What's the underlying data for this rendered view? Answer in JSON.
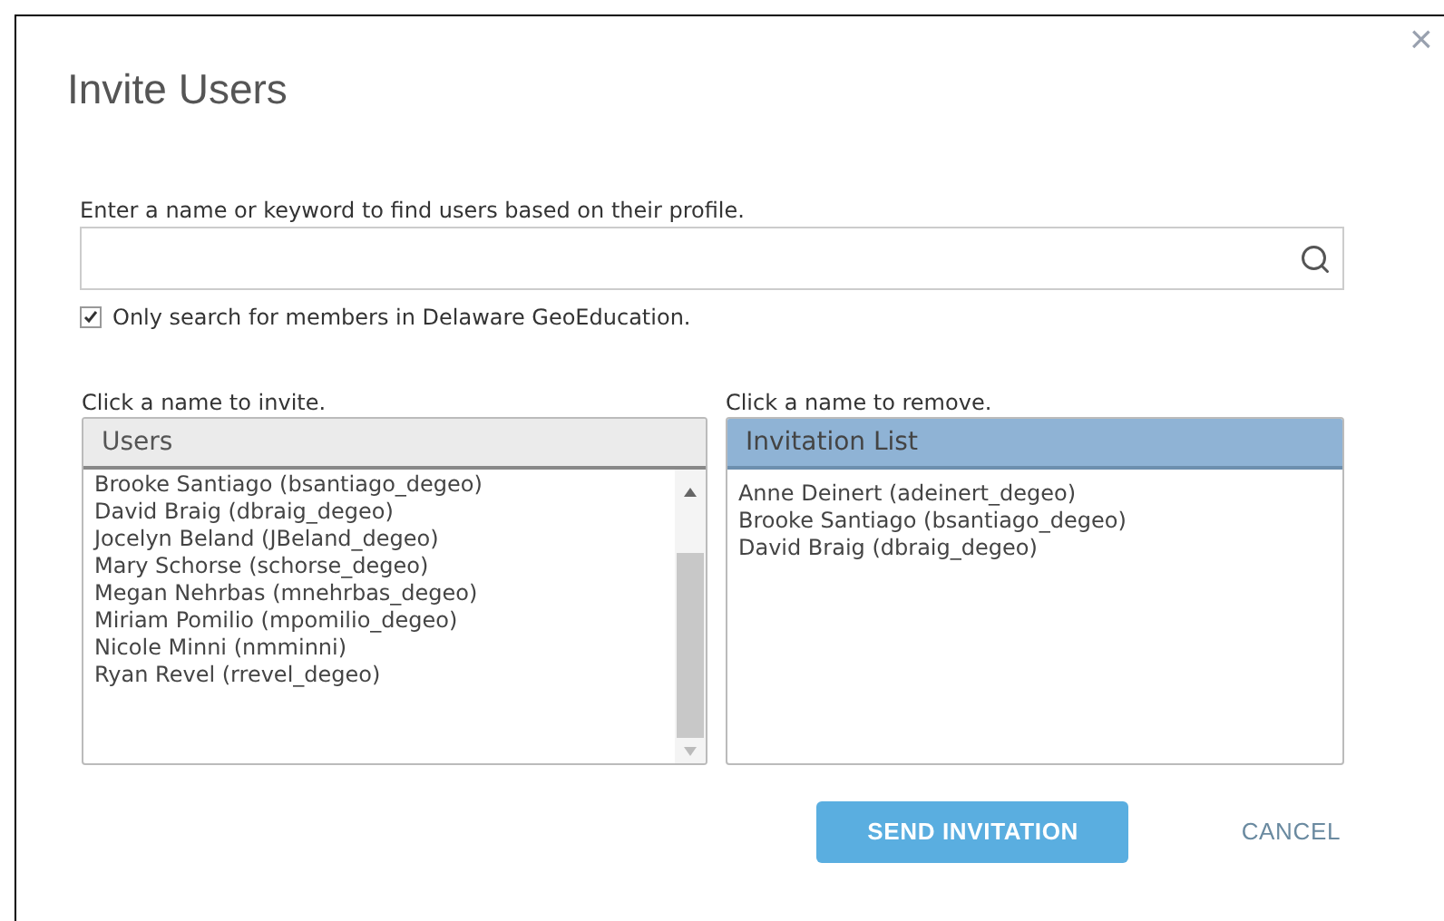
{
  "dialog": {
    "title": "Invite Users",
    "close": "×"
  },
  "search": {
    "label": "Enter a name or keyword to find users based on their profile."
  },
  "filter": {
    "label": "Only search for members in Delaware GeoEducation.",
    "checked": true
  },
  "users": {
    "hint": "Click a name to invite.",
    "header": "Users",
    "items": [
      "Brooke Santiago (bsantiago_degeo)",
      "David Braig (dbraig_degeo)",
      "Jocelyn Beland (JBeland_degeo)",
      "Mary Schorse (schorse_degeo)",
      "Megan Nehrbas (mnehrbas_degeo)",
      "Miriam Pomilio (mpomilio_degeo)",
      "Nicole Minni (nmminni)",
      "Ryan Revel (rrevel_degeo)"
    ]
  },
  "invitations": {
    "hint": "Click a name to remove.",
    "header": "Invitation List",
    "items": [
      "Anne Deinert (adeinert_degeo)",
      "Brooke Santiago (bsantiago_degeo)",
      "David Braig (dbraig_degeo)"
    ]
  },
  "buttons": {
    "send": "SEND INVITATION",
    "cancel": "CANCEL"
  }
}
